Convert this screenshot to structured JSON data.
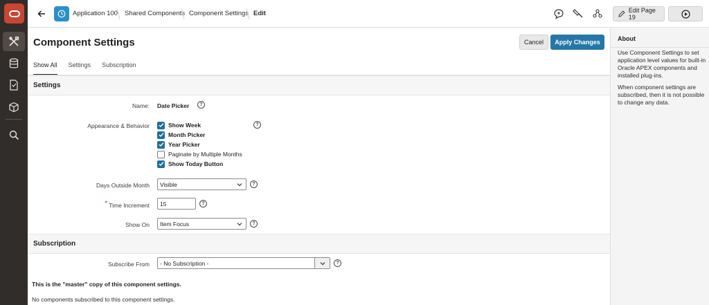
{
  "header": {
    "breadcrumbs": [
      "Application 100",
      "Shared Components",
      "Component Settings",
      "Edit"
    ],
    "edit_page_label": "Edit Page 19"
  },
  "page": {
    "title": "Component Settings",
    "cancel_label": "Cancel",
    "apply_label": "Apply Changes",
    "tabs": [
      "Show All",
      "Settings",
      "Subscription"
    ]
  },
  "settings": {
    "region_title": "Settings",
    "name_label": "Name:",
    "name_value": "Date Picker",
    "appearance_label": "Appearance & Behavior",
    "checkboxes": [
      {
        "label": "Show Week",
        "checked": true
      },
      {
        "label": "Month Picker",
        "checked": true
      },
      {
        "label": "Year Picker",
        "checked": true
      },
      {
        "label": "Paginate by Multiple Months",
        "checked": false
      },
      {
        "label": "Show Today Button",
        "checked": true
      }
    ],
    "days_outside_label": "Days Outside Month",
    "days_outside_value": "Visible",
    "time_increment_label": "Time Increment",
    "time_increment_required": "*",
    "time_increment_value": "15",
    "show_on_label": "Show On",
    "show_on_value": "Item Focus"
  },
  "subscription": {
    "region_title": "Subscription",
    "subscribe_from_label": "Subscribe From",
    "subscribe_from_value": "- No Subscription -",
    "master_note": "This is the \"master\" copy of this component settings.",
    "subscribed_note": "No components subscribed to this component settings."
  },
  "about": {
    "title": "About",
    "para1": "Use Component Settings to set application level values for built-in Oracle APEX components and installed plug-ins.",
    "para2": "When component settings are subscribed, then it is not possible to change any data."
  },
  "help_glyph": "?",
  "colors": {
    "accent": "#2477a8",
    "brand": "#c74634",
    "nav": "#312d2a"
  }
}
